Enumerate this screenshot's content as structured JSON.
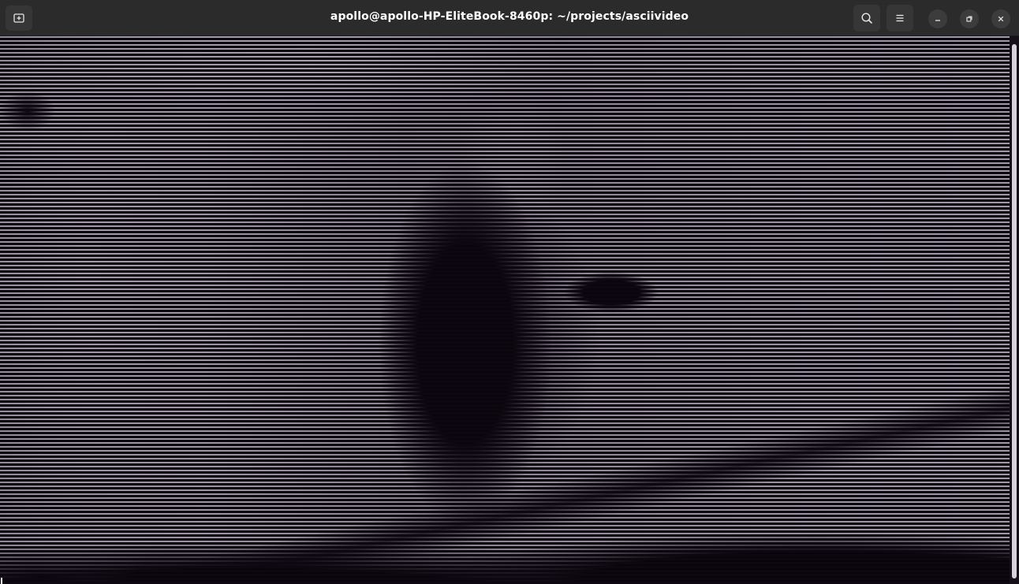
{
  "window": {
    "title": "apollo@apollo-HP-EliteBook-8460p: ~/projects/asciivideo"
  },
  "header": {
    "new_tab_icon": "new-tab-icon",
    "search_icon": "search-icon",
    "menu_icon": "hamburger-menu-icon",
    "minimize_icon": "minimize-icon",
    "maximize_icon": "restore-icon",
    "close_icon": "close-icon"
  },
  "colors": {
    "titlebar": "#2b2b2b",
    "terminal_background": "#0c0710",
    "ascii_light": "#9d96a2",
    "scrollbar_thumb": "#d6d3da"
  },
  "terminal": {
    "content": "ascii-video-frame"
  }
}
